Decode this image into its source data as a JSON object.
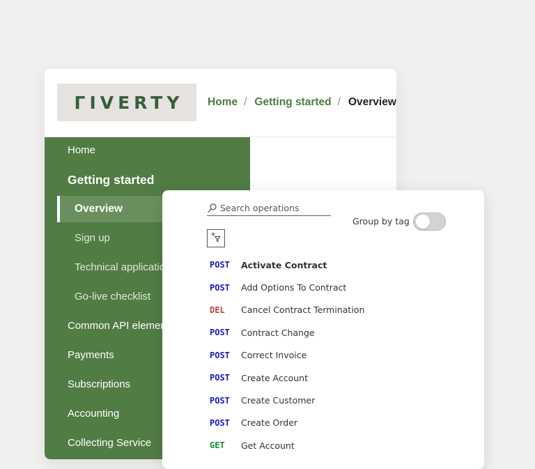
{
  "logo": {
    "text": "ΓIVERTY"
  },
  "breadcrumb": {
    "home": "Home",
    "sep1": "/",
    "getting_started": "Getting started",
    "sep2": "/",
    "current": "Overview"
  },
  "sidebar": {
    "home": "Home",
    "getting_started": "Getting started",
    "overview": "Overview",
    "sign_up": "Sign up",
    "technical_application": "Technical application",
    "go_live_checklist": "Go-live checklist",
    "common_api_elements": "Common API elements",
    "payments": "Payments",
    "subscriptions": "Subscriptions",
    "accounting": "Accounting",
    "collecting_service": "Collecting Service"
  },
  "colors": {
    "sidebar_bg": "#517c44",
    "brand_green": "#355f3b",
    "post": "#1818c8",
    "del": "#c43b3b",
    "get": "#1e8a2c"
  },
  "api_panel": {
    "search_placeholder": "Search operations",
    "group_by_tag_label": "Group by tag",
    "group_by_tag_enabled": false,
    "operations": [
      {
        "method": "POST",
        "name": "Activate Contract"
      },
      {
        "method": "POST",
        "name": "Add Options To Contract"
      },
      {
        "method": "DEL",
        "name": "Cancel Contract Termination"
      },
      {
        "method": "POST",
        "name": "Contract Change"
      },
      {
        "method": "POST",
        "name": "Correct Invoice"
      },
      {
        "method": "POST",
        "name": "Create Account"
      },
      {
        "method": "POST",
        "name": "Create Customer"
      },
      {
        "method": "POST",
        "name": "Create Order"
      },
      {
        "method": "GET",
        "name": "Get Account"
      }
    ]
  }
}
